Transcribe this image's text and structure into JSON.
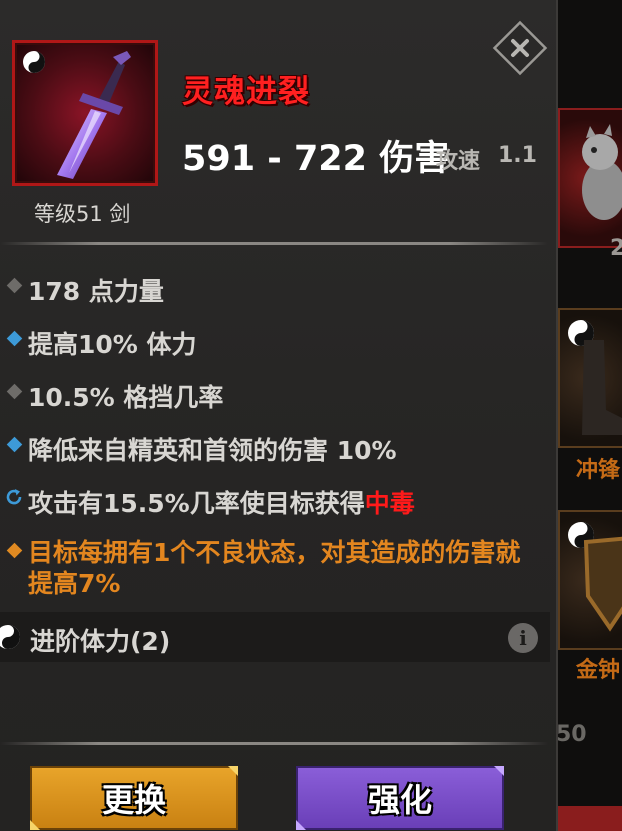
{
  "item": {
    "name": "灵魂进裂",
    "subtitle": "等级51 剑",
    "damage": "591 - 722 伤害",
    "speed_label": "攻速",
    "speed_value": "1.1"
  },
  "stats": [
    {
      "bullet": "gray-diamond",
      "text": "178 点力量"
    },
    {
      "bullet": "blue-diamond",
      "text": "提高10% 体力"
    },
    {
      "bullet": "gray-diamond",
      "text": "10.5% 格挡几率"
    },
    {
      "bullet": "blue-diamond",
      "text": "降低来自精英和首领的伤害 10%"
    },
    {
      "bullet": "cycle-icon",
      "text": "攻击有15.5%几率使目标获得",
      "highlight": "中毒"
    },
    {
      "bullet": "orange-diamond",
      "text": "目标每拥有1个不良状态，对其造成的伤害就提高7%"
    }
  ],
  "set_bonus": {
    "label": "进阶体力(2)",
    "info": "i"
  },
  "buttons": {
    "replace": "更换",
    "enhance": "强化"
  },
  "background": {
    "label_1": "冲锋",
    "label_2": "金钟",
    "num_1": "2",
    "num_2": "50"
  },
  "colors": {
    "item_name": "#ff2020",
    "poison": "#ff1a1a",
    "orange_stat": "#e3861f",
    "replace_button": "#d8931c",
    "enhance_button": "#7a4ec8"
  }
}
